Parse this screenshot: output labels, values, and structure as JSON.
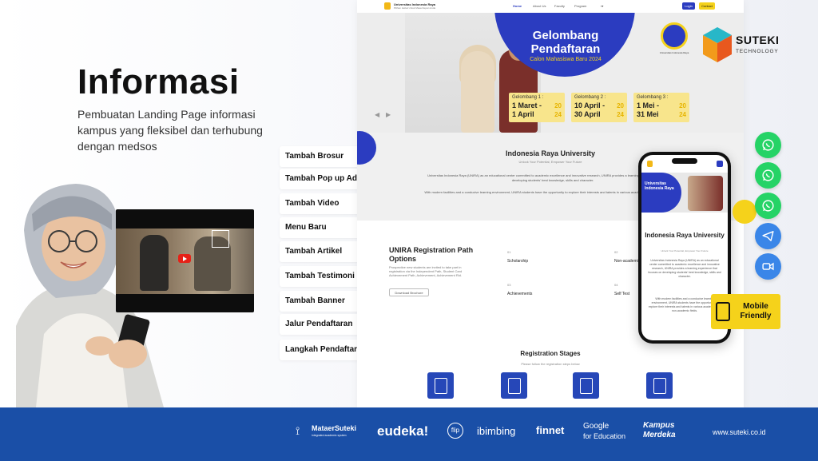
{
  "hero": {
    "title": "Informasi",
    "description": "Pembuatan Landing Page informasi kampus yang fleksibel dan terhubung dengan medsos"
  },
  "brand": {
    "name": "SUTEKI",
    "tagline": "TECHNOLOGY",
    "url": "www.suteki.co.id"
  },
  "features": [
    {
      "label": "Tambah Brosur"
    },
    {
      "label": "Tambah Pop up Ads"
    },
    {
      "label": "Tambah Video"
    },
    {
      "label": "Menu Baru"
    },
    {
      "label": "Tambah Artikel"
    },
    {
      "label": "Tambah Testimoni"
    },
    {
      "label": "Tambah Banner"
    },
    {
      "label": "Jalur Pendaftaran"
    },
    {
      "label": "Langkah Pendaftaran"
    }
  ],
  "website": {
    "brand": "Universitas Indonesia Raya",
    "brand_sub": "Pilihan Hebat Untuk Masa Depan Anda",
    "nav": [
      "Home",
      "About Us",
      "Faculty",
      "Program"
    ],
    "login": "Login",
    "cta": "Contact",
    "banner": {
      "title": "Gelombang Pendaftaran",
      "subtitle": "Calon Mahasiswa Baru 2024",
      "seal_label": "Universitas Indonesia Raya",
      "waves": [
        {
          "label": "Gelombang 1 :",
          "date": "1 Maret -\n1 April",
          "year": "20\n24"
        },
        {
          "label": "Gelombang 2 :",
          "date": "10 April -\n30 April",
          "year": "20\n24"
        },
        {
          "label": "Gelombang 3 :",
          "date": "1 Mei -\n31 Mei",
          "year": "20\n24"
        }
      ]
    },
    "about": {
      "title": "Indonesia Raya University",
      "tagline": "Unlock Your Potential, Empower Your Future",
      "p1": "Universitas Indonesia Raya (UNIRA) as an educational center committed to academic excellence and innovative research, UNIRA provides a learning experience that focuses on developing students' best knowledge, skills and character.",
      "p2": "With modern facilities and a conducive learning environment, UNIRA students have the opportunity to explore their interests and talents in various academic and non-academic fields."
    },
    "registration": {
      "title": "UNIRA Registration Path Options",
      "text": "Prospective new students are invited to take part in registration via the Independent Path, Student Card Achievement Path, Achievement, Achievement Rid.",
      "download": "Download Brochure",
      "paths": [
        {
          "num": "01",
          "label": "Scholarship"
        },
        {
          "num": "02",
          "label": "Non-academic"
        },
        {
          "num": "03",
          "label": "Achievements"
        },
        {
          "num": "04",
          "label": "Self Test"
        }
      ]
    },
    "stages": {
      "title": "Registration Stages",
      "subtitle": "Please follow the registration steps below"
    }
  },
  "phone": {
    "banner_label": "Universitas Indonesia Raya",
    "title": "Indonesia Raya University",
    "tagline": "Unlock Your Potential, Empower Your Future",
    "p1": "Universitas Indonesia Raya (UNIRA) as an educational center committed to academic excellence and innovative research, UNIRA provides a learning experience that focuses on developing students' best knowledge, skills and character.",
    "p2": "With modern facilities and a conducive learning environment, UNIRA students have the opportunity to explore their interests and talents in various academic and non-academic fields."
  },
  "mobile_badge": "Mobile Friendly",
  "social": [
    {
      "icon": "whatsapp-icon",
      "color": "#25d366"
    },
    {
      "icon": "whatsapp-icon",
      "color": "#25d366"
    },
    {
      "icon": "whatsapp-icon",
      "color": "#25d366"
    },
    {
      "icon": "telegram-icon",
      "color": "#3a86e8"
    },
    {
      "icon": "video-call-icon",
      "color": "#3a86e8"
    }
  ],
  "partners": [
    {
      "name": "MataerSuteki",
      "sub": "integrated academic system"
    },
    {
      "name": "eudeka!"
    },
    {
      "name": "flip"
    },
    {
      "name": "ibimbing"
    },
    {
      "name": "finnet"
    },
    {
      "name": "Google",
      "sub": "for Education"
    },
    {
      "name": "Kampus",
      "sub": "Merdeka"
    }
  ],
  "colors": {
    "accent": "#f5d21b",
    "primary": "#2b3cc0",
    "footer": "#1a4fa7"
  }
}
